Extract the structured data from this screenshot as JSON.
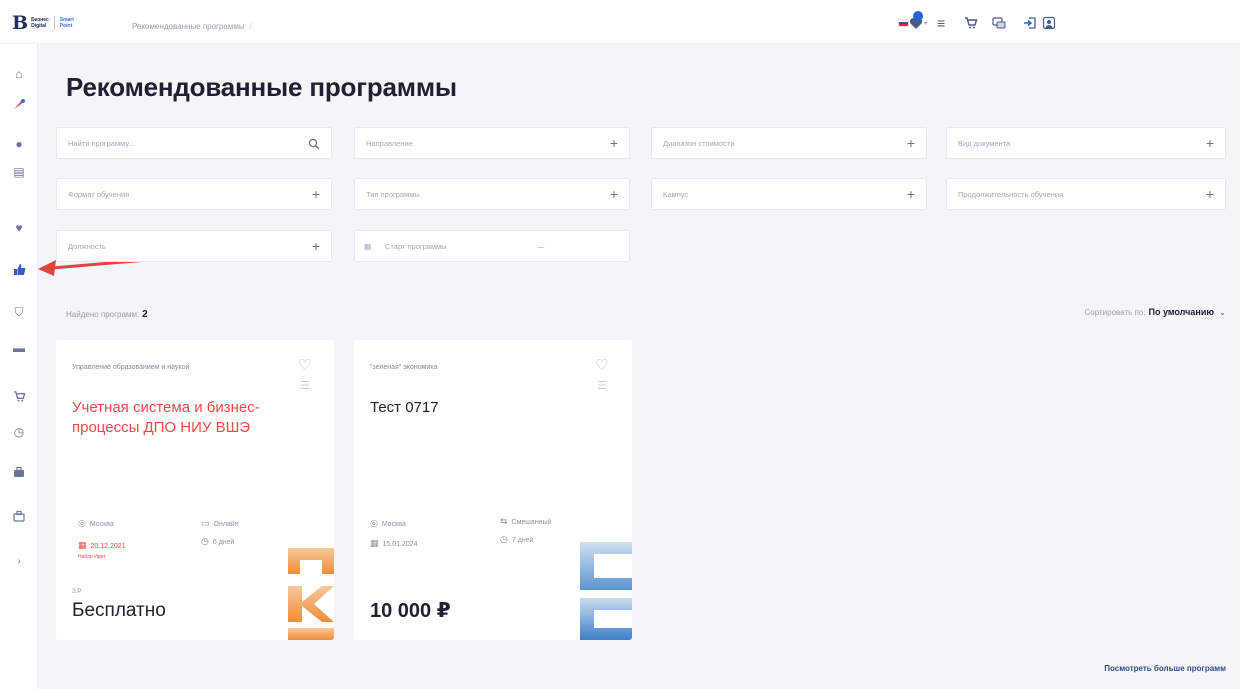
{
  "header": {
    "logo_main": "B",
    "logo_line1": "Бизнес",
    "logo_line2": "Digital",
    "logo_line3": "Smart",
    "logo_line4": "Point",
    "breadcrumb": "Рекомендованные программы",
    "language": "Ру",
    "icons": [
      "flag-icon",
      "notifications-icon",
      "list-icon",
      "cart-icon",
      "chat-icon",
      "logout-icon",
      "user-icon"
    ]
  },
  "sidebar": {
    "items": [
      "home-icon",
      "gift-icon",
      "settings-icon",
      "building-icon",
      "heart-icon",
      "thumbs-up-icon",
      "graduation-icon",
      "folder-icon",
      "cart-icon",
      "clock-icon",
      "briefcase-icon",
      "briefcase-icon",
      "chevron-right-icon"
    ]
  },
  "page": {
    "title": "Рекомендованные программы"
  },
  "filters": {
    "search_placeholder": "Найти программу...",
    "direction": "Направление",
    "price_range": "Диапазон стоимости",
    "doc_type": "Вид документа",
    "format": "Формат обучения",
    "program_type": "Тип программы",
    "campus": "Кампус",
    "duration": "Продолжительность обучения",
    "position": "Должность",
    "date_start": "Старт программы",
    "date_sep": "—"
  },
  "results": {
    "found_label": "Найдено программ:",
    "found_count": "2",
    "sort_label": "Сортировать по:",
    "sort_value": "По умолчанию"
  },
  "cards": [
    {
      "direction": "Управление образованием и наукой",
      "title": "Учетная система и бизнес-процессы ДПО НИУ ВШЭ",
      "city": "Москва",
      "format": "Онлайн",
      "date": "20.12.2021",
      "duration": "6 дней",
      "note": "Набор Идет",
      "small": "З.Р",
      "price": "Бесплатно"
    },
    {
      "direction": "\"зеленая\" экономика",
      "title": "Тест 0717",
      "city": "Москва",
      "format": "Смешанный",
      "date": "15.01.2024",
      "duration": "7 дней",
      "price": "10 000 ₽"
    }
  ],
  "footer": {
    "more_link": "Посмотреть больше программ"
  },
  "colors": {
    "accent_red": "#ea4b49",
    "brand_blue": "#22305a",
    "background": "#f4f5f9"
  }
}
